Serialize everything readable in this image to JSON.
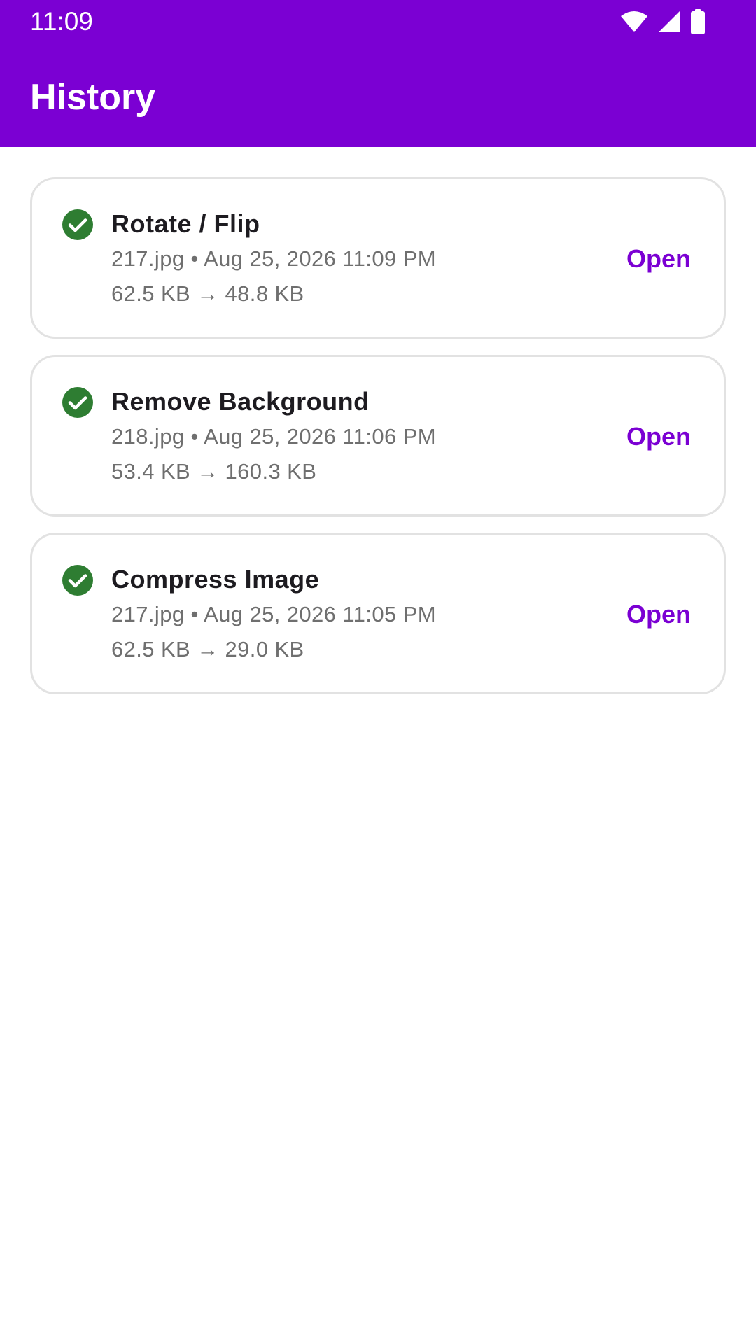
{
  "status_bar": {
    "time": "11:09",
    "icons": [
      "wifi-icon",
      "signal-icon",
      "battery-icon"
    ]
  },
  "app_bar": {
    "title": "History"
  },
  "colors": {
    "primary": "#7b00d3",
    "success": "#2e7d32"
  },
  "history": [
    {
      "title": "Rotate / Flip",
      "meta": "217.jpg • Aug 25, 2026 11:09 PM",
      "size": "62.5 KB → 48.8 KB",
      "action": "Open",
      "status_icon": "check-circle-icon"
    },
    {
      "title": "Remove Background",
      "meta": "218.jpg • Aug 25, 2026 11:06 PM",
      "size": "53.4 KB → 160.3 KB",
      "action": "Open",
      "status_icon": "check-circle-icon"
    },
    {
      "title": "Compress Image",
      "meta": "217.jpg • Aug 25, 2026 11:05 PM",
      "size": "62.5 KB → 29.0 KB",
      "action": "Open",
      "status_icon": "check-circle-icon"
    }
  ]
}
